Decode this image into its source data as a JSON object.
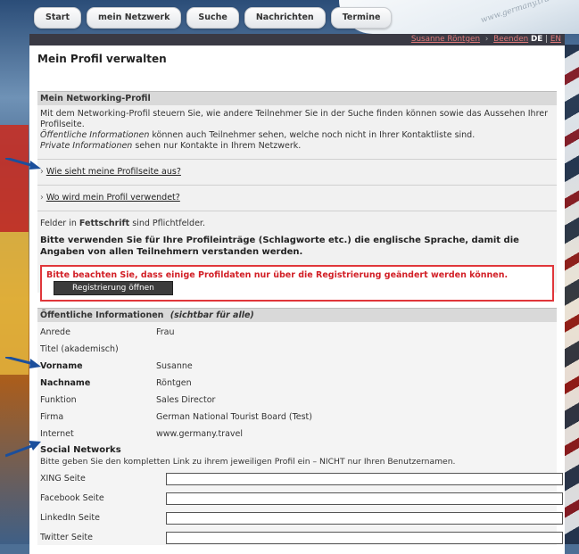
{
  "nav": {
    "tabs": [
      {
        "label": "Start"
      },
      {
        "label": "mein Netzwerk"
      },
      {
        "label": "Suche"
      },
      {
        "label": "Nachrichten"
      },
      {
        "label": "Termine"
      }
    ]
  },
  "userbar": {
    "user_name": "Susanne Röntgen",
    "logout": "Beenden",
    "lang_de": "DE",
    "lang_sep": "|",
    "lang_en": "EN"
  },
  "page": {
    "title": "Mein Profil verwalten"
  },
  "networking": {
    "heading": "Mein Networking-Profil",
    "intro_line1": "Mit dem Networking-Profil steuern Sie, wie andere Teilnehmer Sie in der Suche finden können sowie das Aussehen Ihrer Profilseite.",
    "public_label": "Öffentliche Informationen",
    "public_text": " können auch Teilnehmer sehen, welche noch nicht in Ihrer Kontaktliste sind.",
    "private_label": "Private Informationen",
    "private_text": " sehen nur Kontakte in Ihrem Netzwerk.",
    "link1": "Wie sieht meine Profilseite aus?",
    "link2": "Wo wird mein Profil verwendet?",
    "required_prefix": "Felder in ",
    "required_bold": "Fettschrift",
    "required_suffix": " sind Pflichtfelder.",
    "language_hint": "Bitte verwenden Sie für Ihre Profileinträge (Schlagworte etc.) die englische Sprache, damit die Angaben von allen Teilnehmern verstanden werden.",
    "warning_text": "Bitte beachten Sie, dass einige Profildaten nur über die Registrierung geändert werden können.",
    "warning_button": "Registrierung öffnen"
  },
  "public_info": {
    "heading": "Öffentliche Informationen",
    "heading_note": "(sichtbar für alle)",
    "fields": [
      {
        "label": "Anrede",
        "value": "Frau"
      },
      {
        "label": "Titel (akademisch)",
        "value": ""
      },
      {
        "label": "Vorname",
        "value": "Susanne"
      },
      {
        "label": "Nachname",
        "value": "Röntgen"
      },
      {
        "label": "Funktion",
        "value": "Sales Director"
      },
      {
        "label": "Firma",
        "value": "German National Tourist Board (Test)"
      },
      {
        "label": "Internet",
        "value": "www.germany.travel"
      }
    ]
  },
  "social": {
    "title": "Social Networks",
    "hint": "Bitte geben Sie den kompletten Link zu ihrem jeweiligen Profil ein – NICHT nur Ihren Benutzernamen.",
    "fields": [
      {
        "label": "XING Seite",
        "value": ""
      },
      {
        "label": "Facebook Seite",
        "value": ""
      },
      {
        "label": "LinkedIn Seite",
        "value": ""
      },
      {
        "label": "Twitter Seite",
        "value": ""
      }
    ]
  },
  "branding": {
    "watermark": "www.germany.travel"
  },
  "colors": {
    "warning": "#d21f26",
    "topbar": "#3a3a44",
    "arrow": "#1b4f9c"
  }
}
